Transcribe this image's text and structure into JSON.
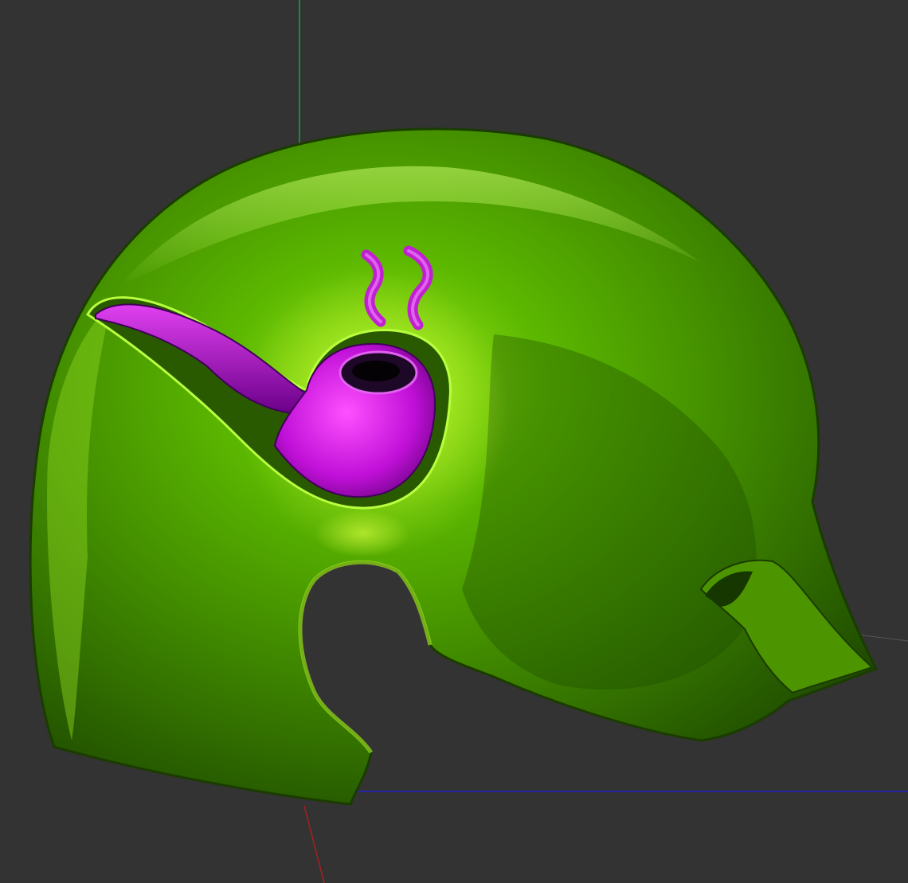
{
  "viewport": {
    "background": "#333333",
    "axes": {
      "x_color": "#2323c8",
      "y_color": "#16a83a",
      "z_color": "#a82020",
      "secondary_color": "#555555"
    }
  },
  "model": {
    "name": "helmet",
    "body_color": "#4a9a00",
    "highlight_color": "#a8f020",
    "shadow_color": "#143000",
    "emblem": {
      "icon": "smoking-pipe-icon",
      "color": "#e020f0",
      "shadow_color": "#5a0070"
    }
  }
}
